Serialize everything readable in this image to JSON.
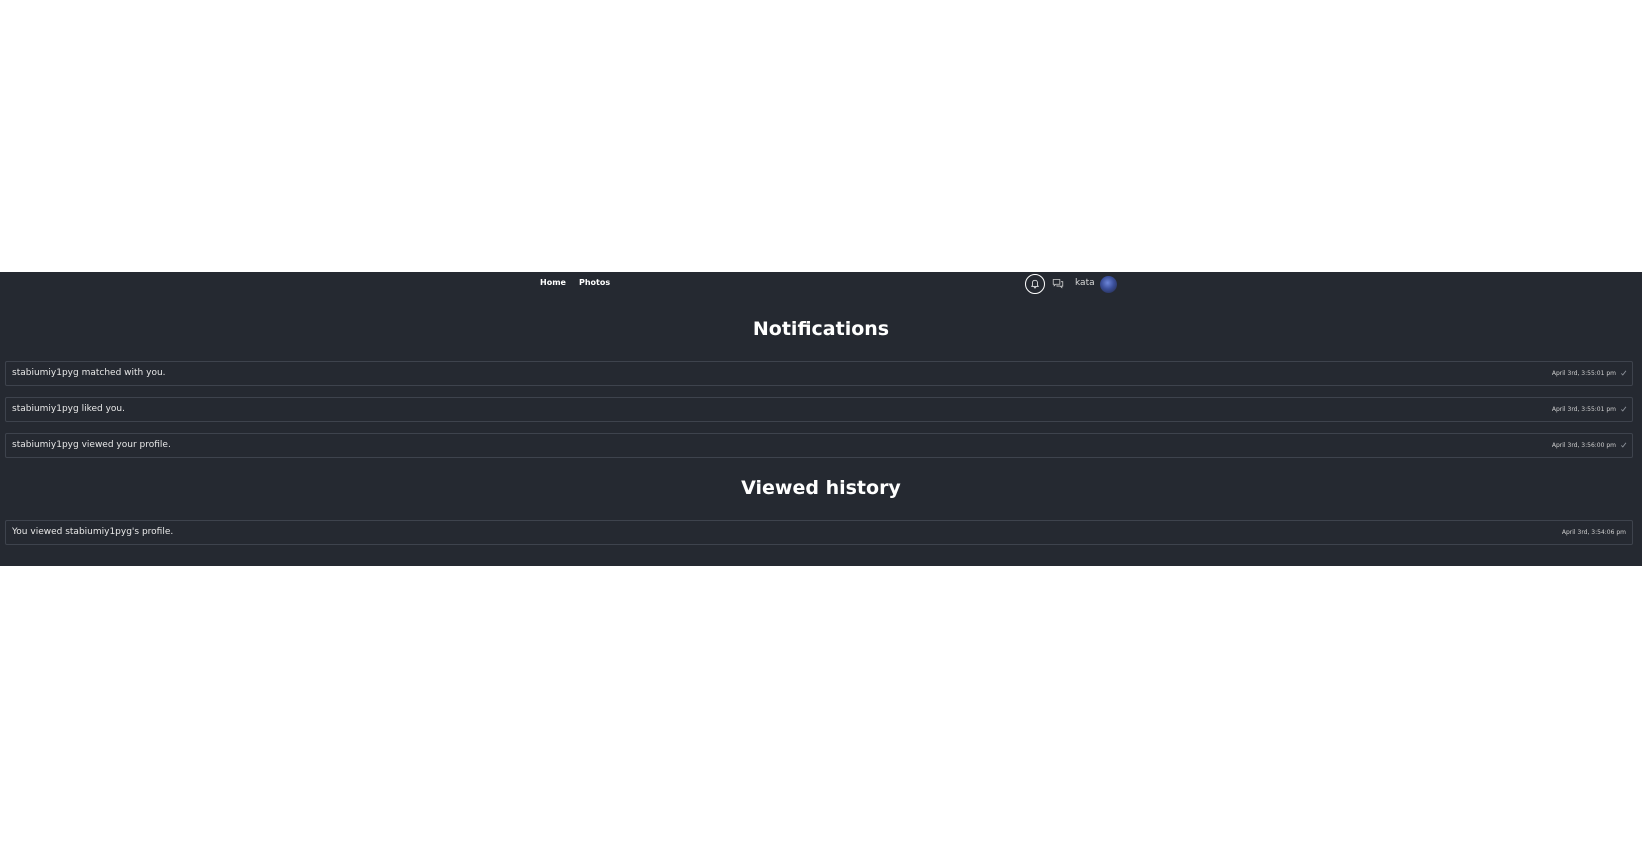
{
  "nav": {
    "home_label": "Home",
    "photos_label": "Photos",
    "username": "kata",
    "bell_icon": "bell-icon",
    "chat_icon": "chat-icon"
  },
  "notifications": {
    "title": "Notifications",
    "items": [
      {
        "text": "stabiumiy1pyg matched with you.",
        "time": "April 3rd, 3:55:01 pm"
      },
      {
        "text": "stabiumiy1pyg liked you.",
        "time": "April 3rd, 3:55:01 pm"
      },
      {
        "text": "stabiumiy1pyg viewed your profile.",
        "time": "April 3rd, 3:56:00 pm"
      }
    ]
  },
  "history": {
    "title": "Viewed history",
    "items": [
      {
        "text": "You viewed stabiumiy1pyg's profile.",
        "time": "April 3rd, 3:54:06 pm"
      }
    ]
  },
  "colors": {
    "background": "#252931",
    "border": "#3e434d",
    "text": "#ffffff"
  }
}
